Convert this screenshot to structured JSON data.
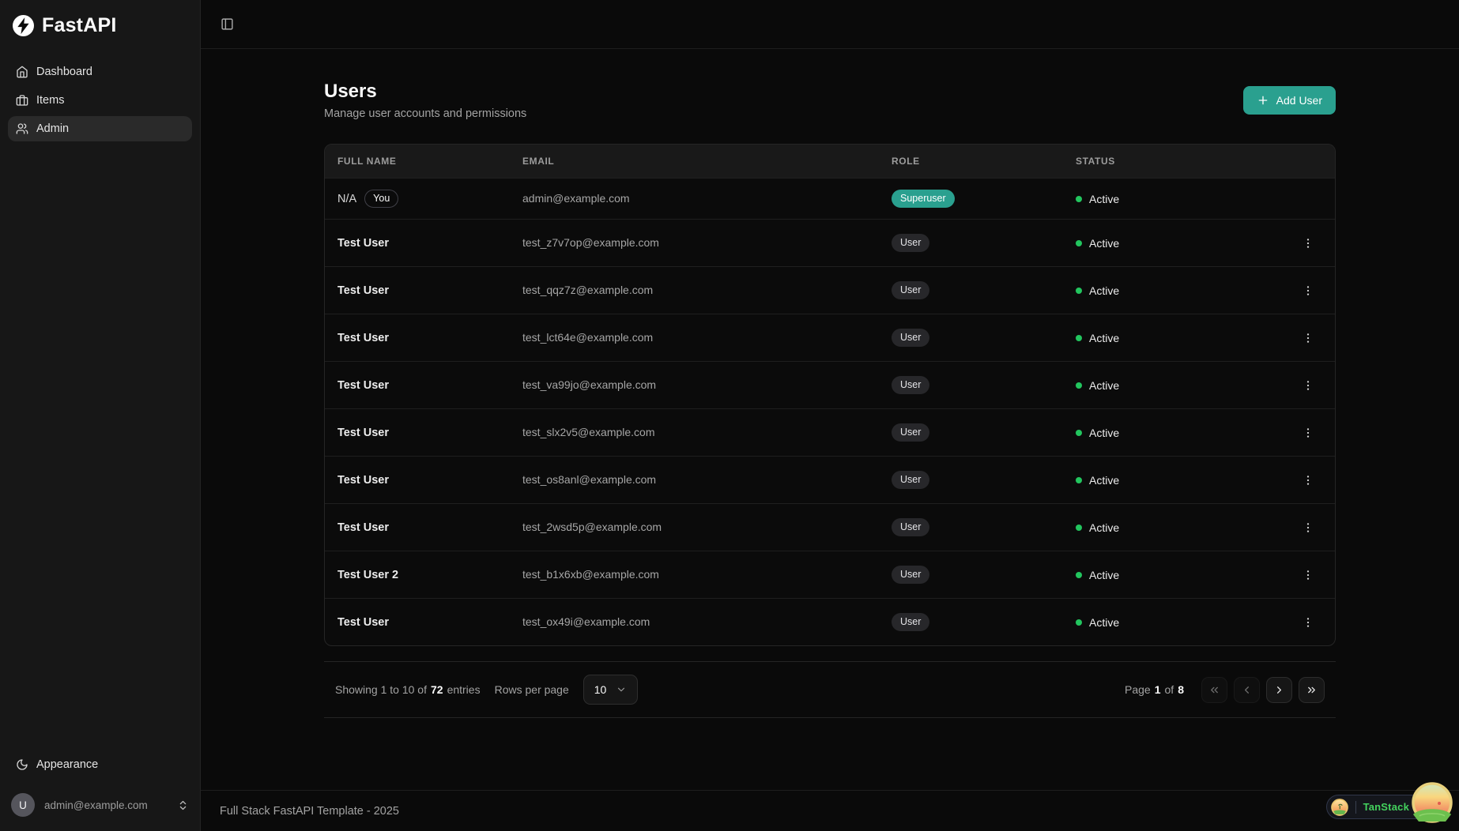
{
  "sidebar": {
    "logo_text": "FastAPI",
    "items": [
      {
        "label": "Dashboard",
        "icon": "house-icon"
      },
      {
        "label": "Items",
        "icon": "briefcase-icon"
      },
      {
        "label": "Admin",
        "icon": "users-icon",
        "active": true
      }
    ],
    "appearance_label": "Appearance",
    "user": {
      "initial": "U",
      "email": "admin@example.com"
    }
  },
  "page": {
    "title": "Users",
    "subtitle": "Manage user accounts and permissions",
    "add_user_label": "Add User"
  },
  "table": {
    "columns": [
      "Full Name",
      "Email",
      "Role",
      "Status"
    ],
    "rows": [
      {
        "name": "N/A",
        "you_badge": "You",
        "email": "admin@example.com",
        "role": "Superuser",
        "status": "Active"
      },
      {
        "name": "Test User",
        "email": "test_z7v7op@example.com",
        "role": "User",
        "status": "Active"
      },
      {
        "name": "Test User",
        "email": "test_qqz7z@example.com",
        "role": "User",
        "status": "Active"
      },
      {
        "name": "Test User",
        "email": "test_lct64e@example.com",
        "role": "User",
        "status": "Active"
      },
      {
        "name": "Test User",
        "email": "test_va99jo@example.com",
        "role": "User",
        "status": "Active"
      },
      {
        "name": "Test User",
        "email": "test_slx2v5@example.com",
        "role": "User",
        "status": "Active"
      },
      {
        "name": "Test User",
        "email": "test_os8anl@example.com",
        "role": "User",
        "status": "Active"
      },
      {
        "name": "Test User",
        "email": "test_2wsd5p@example.com",
        "role": "User",
        "status": "Active"
      },
      {
        "name": "Test User 2",
        "email": "test_b1x6xb@example.com",
        "role": "User",
        "status": "Active"
      },
      {
        "name": "Test User",
        "email": "test_ox49i@example.com",
        "role": "User",
        "status": "Active"
      }
    ]
  },
  "pagination": {
    "showing": {
      "prefix": "Showing 1 to 10 of",
      "count": "72",
      "suffix": "entries"
    },
    "rows_per_page": {
      "label": "Rows per page",
      "value": "10"
    },
    "page": {
      "label": "Page",
      "current": "1",
      "of": "of",
      "total": "8"
    }
  },
  "footer": {
    "text": "Full Stack FastAPI Template - 2025"
  },
  "devtools": {
    "label": "TanStack"
  },
  "colors": {
    "accent_teal": "#2aa08f",
    "status_green": "#22c55e",
    "sidebar_bg": "#171717",
    "main_bg": "#0a0a0a",
    "devtools_green": "#43d15d"
  }
}
